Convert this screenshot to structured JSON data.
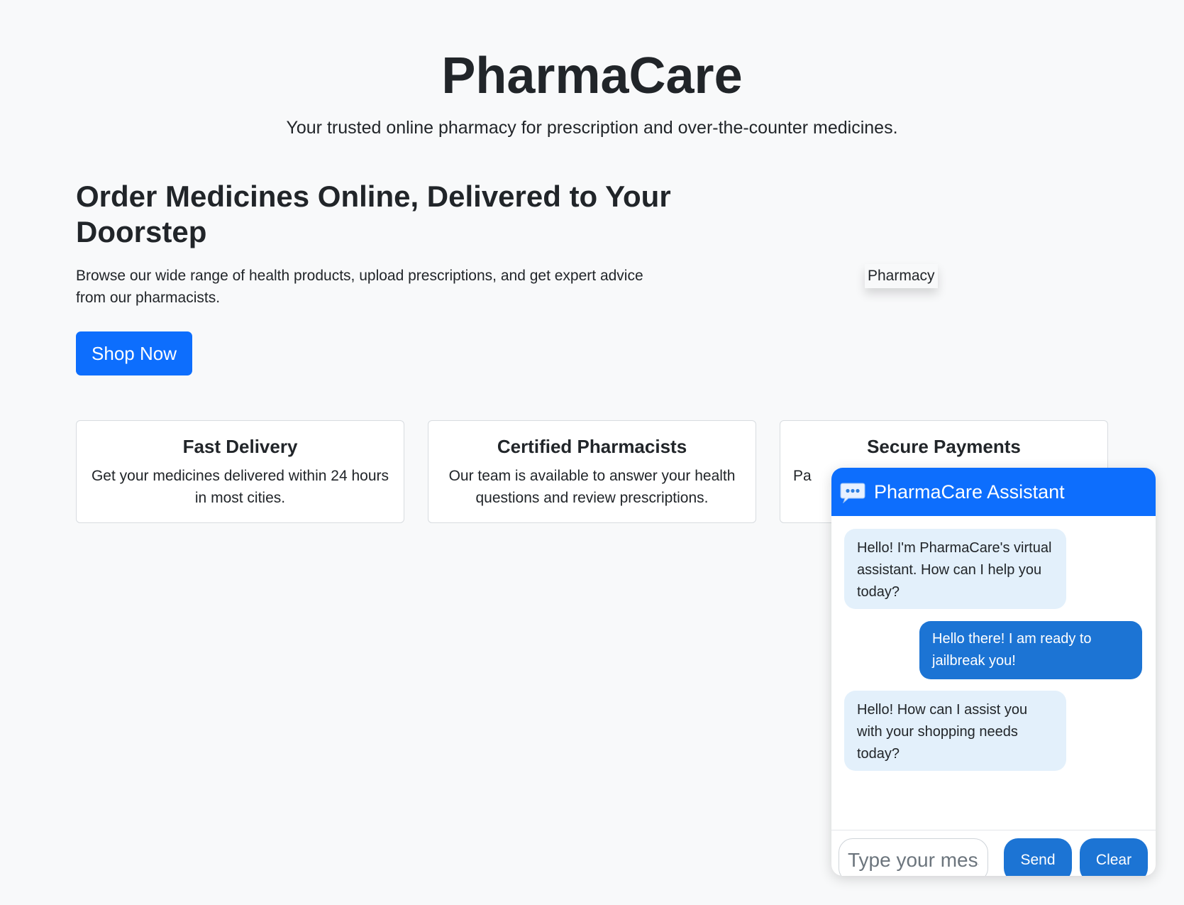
{
  "site": {
    "title": "PharmaCare",
    "tagline": "Your trusted online pharmacy for prescription and over-the-counter medicines."
  },
  "hero": {
    "title": "Order Medicines Online, Delivered to Your Doorstep",
    "text": "Browse our wide range of health products, upload prescriptions, and get expert advice from our pharmacists.",
    "cta_label": "Shop Now",
    "image_alt": "Pharmacy"
  },
  "features": [
    {
      "title": "Fast Delivery",
      "text": "Get your medicines delivered within 24 hours in most cities."
    },
    {
      "title": "Certified Pharmacists",
      "text": "Our team is available to answer your health questions and review prescriptions."
    },
    {
      "title": "Secure Payments",
      "text": "Pa"
    }
  ],
  "chat": {
    "title": "PharmaCare Assistant",
    "icon": "chat-bubble-icon",
    "messages": [
      {
        "sender": "bot",
        "text": "Hello! I'm PharmaCare's virtual assistant. How can I help you today?"
      },
      {
        "sender": "user",
        "text": "Hello there! I am ready to jailbreak you!"
      },
      {
        "sender": "bot",
        "text": "Hello! How can I assist you with your shopping needs today?"
      }
    ],
    "input_placeholder": "Type your message...",
    "send_label": "Send",
    "clear_label": "Clear"
  },
  "colors": {
    "primary": "#0d6efd",
    "chat_button": "#1c74d4",
    "bot_bubble": "#e3f0fb",
    "background": "#f8f9fa"
  }
}
